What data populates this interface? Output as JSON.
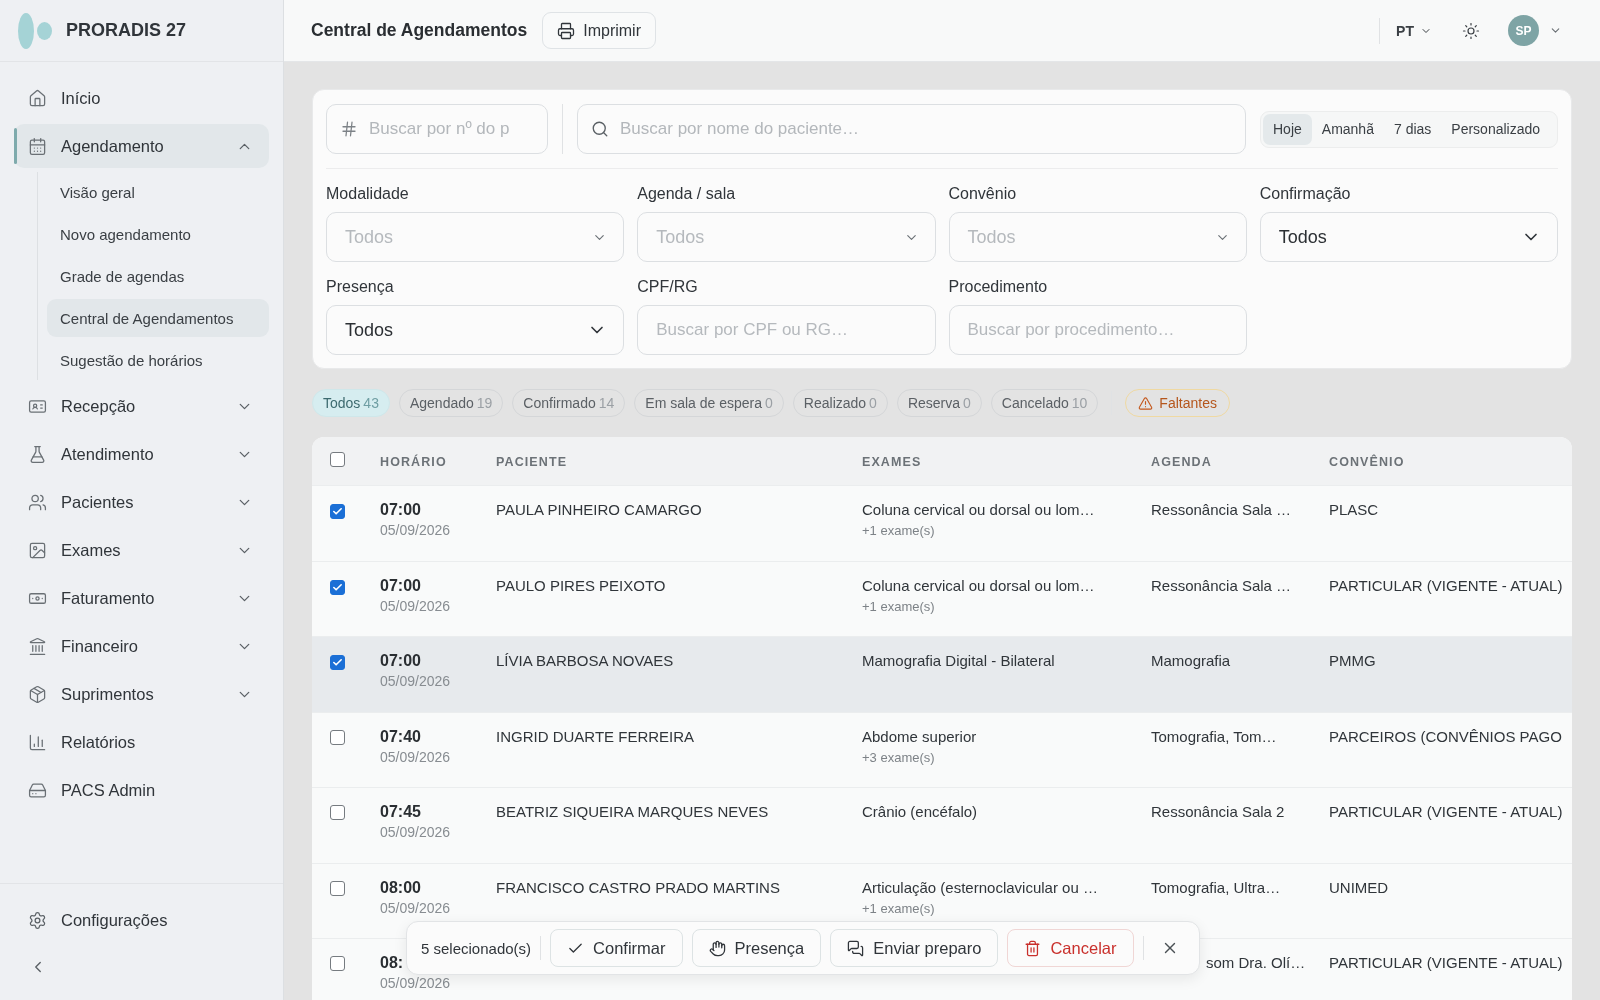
{
  "sidebar": {
    "brand": "PRORADIS 27",
    "items": [
      {
        "kind": "link",
        "label": "Início",
        "selected": false
      },
      {
        "kind": "group",
        "label": "Agendamento",
        "selected": true,
        "expanded": true,
        "children": [
          {
            "label": "Visão geral",
            "selected": false
          },
          {
            "label": "Novo agendamento",
            "selected": false
          },
          {
            "label": "Grade de agendas",
            "selected": false
          },
          {
            "label": "Central de Agendamentos",
            "selected": true
          },
          {
            "label": "Sugestão de horários",
            "selected": false
          }
        ]
      },
      {
        "kind": "group",
        "label": "Recepção",
        "selected": false,
        "expanded": false
      },
      {
        "kind": "group",
        "label": "Atendimento",
        "selected": false,
        "expanded": false
      },
      {
        "kind": "group",
        "label": "Pacientes",
        "selected": false,
        "expanded": false
      },
      {
        "kind": "group",
        "label": "Exames",
        "selected": false,
        "expanded": false
      },
      {
        "kind": "group",
        "label": "Faturamento",
        "selected": false,
        "expanded": false
      },
      {
        "kind": "group",
        "label": "Financeiro",
        "selected": false,
        "expanded": false
      },
      {
        "kind": "group",
        "label": "Suprimentos",
        "selected": false,
        "expanded": false
      },
      {
        "kind": "link",
        "label": "Relatórios",
        "selected": false
      },
      {
        "kind": "link",
        "label": "PACS Admin",
        "selected": false
      }
    ],
    "footer_items": [
      {
        "label": "Configurações"
      }
    ]
  },
  "topbar": {
    "title": "Central de Agendamentos",
    "print_button": "Imprimir",
    "language": "PT",
    "user_initials": "SP"
  },
  "filters": {
    "number_search": {
      "placeholder": "Buscar por nº do p"
    },
    "name_search": {
      "placeholder": "Buscar por nome do paciente…"
    },
    "date_range": [
      {
        "label": "Hoje",
        "selected": true
      },
      {
        "label": "Amanhã",
        "selected": false
      },
      {
        "label": "7 dias",
        "selected": false
      },
      {
        "label": "Personalizado",
        "selected": false
      }
    ],
    "fields": [
      {
        "kind": "select",
        "label": "Modalidade",
        "placeholder": "Todos"
      },
      {
        "kind": "select",
        "label": "Agenda / sala",
        "placeholder": "Todos"
      },
      {
        "kind": "select",
        "label": "Convênio",
        "placeholder": "Todos"
      },
      {
        "kind": "select",
        "label": "Confirmação",
        "value": "Todos"
      },
      {
        "kind": "select",
        "label": "Presença",
        "value": "Todos"
      },
      {
        "kind": "text",
        "label": "CPF/RG",
        "placeholder": "Buscar por CPF ou RG…"
      },
      {
        "kind": "text",
        "label": "Procedimento",
        "placeholder": "Buscar por procedimento…"
      }
    ]
  },
  "status_filters": {
    "chips": [
      {
        "label": "Todos",
        "count": "43",
        "selected": true
      },
      {
        "label": "Agendado",
        "count": "19",
        "selected": false
      },
      {
        "label": "Confirmado",
        "count": "14",
        "selected": false
      },
      {
        "label": "Em sala de espera",
        "count": "0",
        "selected": false
      },
      {
        "label": "Realizado",
        "count": "0",
        "selected": false
      },
      {
        "label": "Reserva",
        "count": "0",
        "selected": false
      },
      {
        "label": "Cancelado",
        "count": "10",
        "selected": false
      }
    ],
    "warning_chip": {
      "label": "Faltantes"
    }
  },
  "table": {
    "select_all": {
      "checked": false
    },
    "columns": [
      "HORÁRIO",
      "PACIENTE",
      "EXAMES",
      "AGENDA",
      "CONVÊNIO"
    ],
    "rows": [
      {
        "kind": "full",
        "checked": true,
        "hovered": false,
        "time": "07:00",
        "date": "05/09/2026",
        "patient": "PAULA PINHEIRO CAMARGO",
        "exam": "Coluna cervical ou dorsal ou lom…",
        "exam_extra": "+1 exame(s)",
        "agenda": "Ressonância Sala …",
        "insurance": "PLASC"
      },
      {
        "kind": "full",
        "checked": true,
        "hovered": false,
        "time": "07:00",
        "date": "05/09/2026",
        "patient": "PAULO PIRES PEIXOTO",
        "exam": "Coluna cervical ou dorsal ou lom…",
        "exam_extra": "+1 exame(s)",
        "agenda": "Ressonância Sala …",
        "insurance": "PARTICULAR (VIGENTE - ATUAL)"
      },
      {
        "kind": "full",
        "checked": true,
        "hovered": true,
        "time": "07:00",
        "date": "05/09/2026",
        "patient": "LÍVIA BARBOSA NOVAES",
        "exam": "Mamografia Digital - Bilateral",
        "agenda": "Mamografia",
        "insurance": "PMMG"
      },
      {
        "kind": "full",
        "checked": false,
        "hovered": false,
        "time": "07:40",
        "date": "05/09/2026",
        "patient": "INGRID DUARTE FERREIRA",
        "exam": "Abdome superior",
        "exam_extra": "+3 exame(s)",
        "agenda": "Tomografia, Tom…",
        "insurance": "PARCEIROS (CONVÊNIOS PAGO"
      },
      {
        "kind": "full",
        "checked": false,
        "hovered": false,
        "time": "07:45",
        "date": "05/09/2026",
        "patient": "BEATRIZ SIQUEIRA MARQUES NEVES",
        "exam": "Crânio (encéfalo)",
        "agenda": "Ressonância Sala 2",
        "insurance": "PARTICULAR (VIGENTE - ATUAL)"
      },
      {
        "kind": "full",
        "checked": false,
        "hovered": false,
        "time": "08:00",
        "date": "05/09/2026",
        "patient": "FRANCISCO CASTRO PRADO MARTINS",
        "exam": "Articulação (esternoclavicular ou …",
        "exam_extra": "+1 exame(s)",
        "agenda": "Tomografia, Ultra…",
        "insurance": "UNIMED"
      },
      {
        "kind": "covered",
        "checked": false,
        "hovered": false,
        "time": "08:",
        "date": "05/09/2026",
        "agenda": "som Dra. Olí…",
        "insurance": "PARTICULAR (VIGENTE - ATUAL)"
      }
    ]
  },
  "selection_bar": {
    "count_label": "5 selecionado(s)",
    "actions": [
      {
        "kind": "confirm",
        "label": "Confirmar"
      },
      {
        "kind": "presence",
        "label": "Presença"
      },
      {
        "kind": "send",
        "label": "Enviar preparo"
      },
      {
        "kind": "danger",
        "label": "Cancelar"
      }
    ]
  }
}
